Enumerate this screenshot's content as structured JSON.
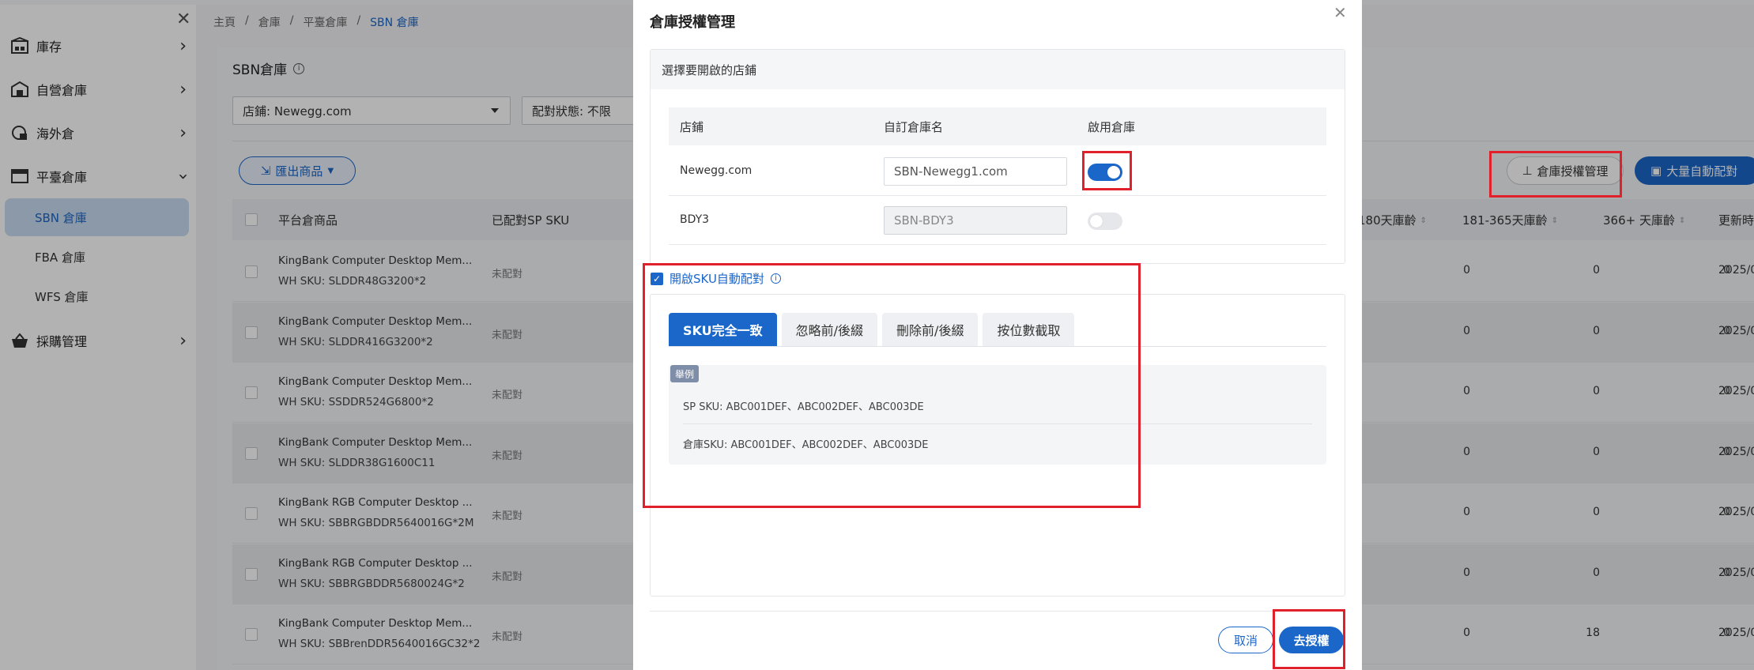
{
  "breadcrumb": [
    "主頁",
    "倉庫",
    "平臺倉庫",
    "SBN 倉庫"
  ],
  "sidebar": {
    "items": [
      {
        "label": "庫存"
      },
      {
        "label": "自營倉庫"
      },
      {
        "label": "海外倉"
      },
      {
        "label": "平臺倉庫"
      },
      {
        "label": "採購管理"
      }
    ],
    "subitems": [
      {
        "label": "SBN 倉庫"
      },
      {
        "label": "FBA 倉庫"
      },
      {
        "label": "WFS 倉庫"
      }
    ]
  },
  "page": {
    "title": "SBN倉庫",
    "store_filter": "店鋪: Newegg.com",
    "match_filter": "配對狀態: 不限",
    "export_label": "匯出商品",
    "auth_label": "倉庫授權管理",
    "bulk_label": "大量自動配對"
  },
  "table": {
    "headers": {
      "product": "平台倉商品",
      "sku": "已配對SP SKU",
      "age180": "180天庫齡",
      "age365": "181-365天庫齡",
      "age366": "366+ 天庫齡",
      "updated": "更新時"
    },
    "rows": [
      {
        "name": "KingBank Computer Desktop Mem...",
        "sku": "WH SKU: SLDDR48G3200*2",
        "status": "未配對",
        "a": "0",
        "b": "0",
        "c": "0",
        "date": "2025/0"
      },
      {
        "name": "KingBank Computer Desktop Mem...",
        "sku": "WH SKU: SLDDR416G3200*2",
        "status": "未配對",
        "a": "0",
        "b": "0",
        "c": "0",
        "date": "2025/0"
      },
      {
        "name": "KingBank Computer Desktop Mem...",
        "sku": "WH SKU: SSDDR524G6800*2",
        "status": "未配對",
        "a": "0",
        "b": "0",
        "c": "0",
        "date": "2025/0"
      },
      {
        "name": "KingBank Computer Desktop Mem...",
        "sku": "WH SKU: SLDDR38G1600C11",
        "status": "未配對",
        "a": "0",
        "b": "0",
        "c": "0",
        "date": "2025/0"
      },
      {
        "name": "KingBank RGB Computer Desktop ...",
        "sku": "WH SKU: SBBRGBDDR5640016G*2M",
        "status": "未配對",
        "a": "0",
        "b": "0",
        "c": "0",
        "date": "2025/0"
      },
      {
        "name": "KingBank RGB Computer Desktop ...",
        "sku": "WH SKU: SBBRGBDDR5680024G*2",
        "status": "未配對",
        "a": "0",
        "b": "0",
        "c": "0",
        "date": "2025/0"
      },
      {
        "name": "KingBank Computer Desktop Mem...",
        "sku": "WH SKU: SBBrenDDR5640016GC32*2",
        "status": "未配對",
        "a": "0",
        "b": "18",
        "c": "0",
        "date": "2025/0"
      }
    ]
  },
  "modal": {
    "title": "倉庫授權管理",
    "section_title": "選擇要開啟的店鋪",
    "col_store": "店鋪",
    "col_name": "自訂倉庫名",
    "col_enable": "啟用倉庫",
    "stores": [
      {
        "store": "Newegg.com",
        "name": "SBN-Newegg1.com",
        "enabled": true
      },
      {
        "store": "BDY3",
        "name": "SBN-BDY3",
        "enabled": false
      }
    ],
    "auto_label": "開啟SKU自動配對",
    "tabs": [
      "SKU完全一致",
      "忽略前/後綴",
      "刪除前/後綴",
      "按位數截取"
    ],
    "example_badge": "舉例",
    "example_sp": "SP SKU: ABC001DEF、ABC002DEF、ABC003DE",
    "example_wh": "倉庫SKU: ABC001DEF、ABC002DEF、ABC003DE",
    "cancel_label": "取消",
    "confirm_label": "去授權"
  },
  "colors": {
    "accent": "#1b66c9",
    "highlight": "#e0202a"
  }
}
